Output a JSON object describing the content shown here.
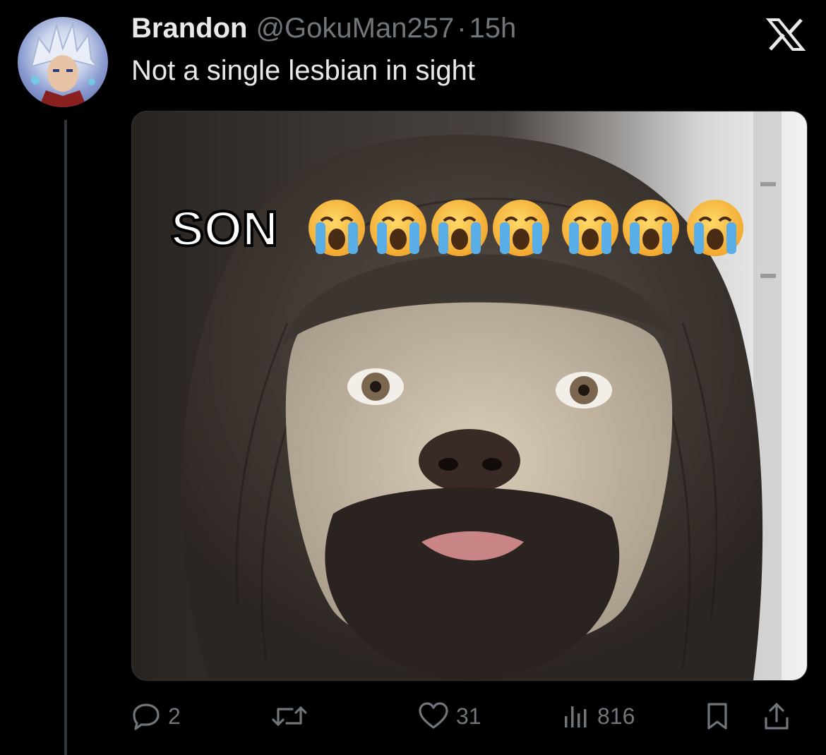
{
  "tweet": {
    "author_name": "Brandon",
    "author_handle": "@GokuMan257",
    "separator": "·",
    "time": "15h",
    "text": "Not a single lesbian in sight"
  },
  "media": {
    "overlay_text": "SON",
    "emoji_icon": "loudly-crying-face-icon",
    "emoji_count": 7
  },
  "actions": {
    "reply_count": "2",
    "retweet_count": "",
    "like_count": "31",
    "views_count": "816"
  },
  "icons": {
    "logo": "x-logo-icon",
    "reply": "reply-icon",
    "retweet": "retweet-icon",
    "like": "heart-icon",
    "views": "views-icon",
    "bookmark": "bookmark-icon",
    "share": "share-icon"
  },
  "colors": {
    "background": "#000000",
    "primary_text": "#e7e9ea",
    "secondary_text": "#71767b",
    "thread_line": "#333639"
  }
}
